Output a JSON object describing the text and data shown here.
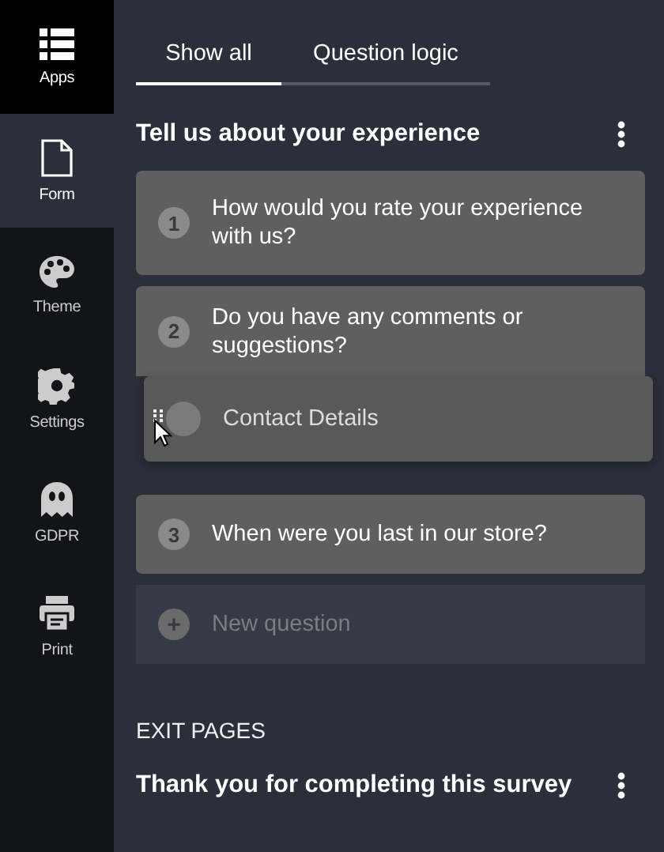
{
  "sidebar": {
    "items": [
      {
        "label": "Apps",
        "kind": "header",
        "selected": false
      },
      {
        "label": "Form",
        "kind": "item",
        "selected": true
      },
      {
        "label": "Theme",
        "kind": "item",
        "selected": false
      },
      {
        "label": "Settings",
        "kind": "item",
        "selected": false
      },
      {
        "label": "GDPR",
        "kind": "item",
        "selected": false
      },
      {
        "label": "Print",
        "kind": "item",
        "selected": false
      }
    ]
  },
  "tabs": [
    {
      "label": "Show all",
      "selected": true
    },
    {
      "label": "Question logic",
      "selected": false
    }
  ],
  "section": {
    "title": "Tell us about your experience"
  },
  "questions": [
    {
      "number": "1",
      "text": "How would you rate your experience with us?"
    },
    {
      "number": "2",
      "text": "Do you have any comments or suggestions?"
    },
    {
      "number": "3",
      "text": "When were you last in our store?"
    }
  ],
  "dragged_item": {
    "text": "Contact Details"
  },
  "new_question": {
    "icon": "+",
    "label": "New question"
  },
  "exit_pages": {
    "heading": "EXIT PAGES",
    "items": [
      {
        "title": "Thank you for completing this survey"
      }
    ]
  }
}
